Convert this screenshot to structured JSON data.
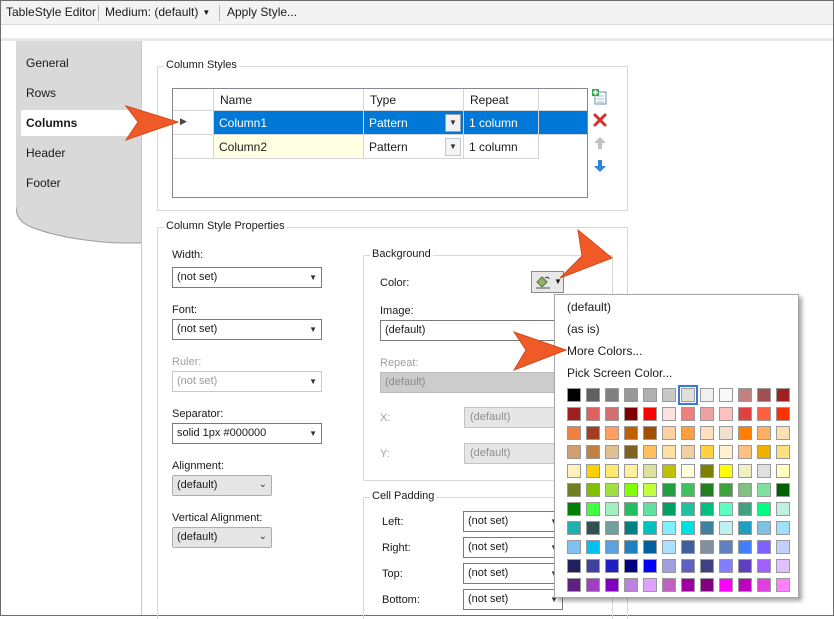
{
  "toolbar": {
    "title": "TableStyle Editor",
    "medium_label": "Medium: (default)",
    "apply_label": "Apply Style..."
  },
  "nav": {
    "items": [
      "General",
      "Rows",
      "Columns",
      "Header",
      "Footer"
    ],
    "selected": "Columns"
  },
  "column_styles": {
    "title": "Column Styles",
    "headers": [
      "Name",
      "Type",
      "Repeat"
    ],
    "rows": [
      {
        "name": "Column1",
        "type": "Pattern",
        "repeat": "1 column",
        "selected": true
      },
      {
        "name": "Column2",
        "type": "Pattern",
        "repeat": "1 column",
        "selected": false
      }
    ],
    "icons": [
      "add-row-icon",
      "delete-row-icon",
      "move-up-icon",
      "move-down-icon"
    ]
  },
  "properties": {
    "title": "Column Style Properties",
    "width_label": "Width:",
    "width_value": "(not set)",
    "font_label": "Font:",
    "font_value": "(not set)",
    "ruler_label": "Ruler:",
    "ruler_value": "(not set)",
    "separator_label": "Separator:",
    "separator_value": "solid 1px #000000",
    "alignment_label": "Alignment:",
    "alignment_value": "(default)",
    "valign_label": "Vertical Alignment:",
    "valign_value": "(default)"
  },
  "background": {
    "title": "Background",
    "color_label": "Color:",
    "image_label": "Image:",
    "image_value": "(default)",
    "repeat_label": "Repeat:",
    "repeat_value": "(default)",
    "x_label": "X:",
    "x_value": "(default)",
    "y_label": "Y:",
    "y_value": "(default)"
  },
  "cell_padding": {
    "title": "Cell Padding",
    "left_label": "Left:",
    "left_value": "(not set)",
    "right_label": "Right:",
    "right_value": "(not set)",
    "top_label": "Top:",
    "top_value": "(not set)",
    "bottom_label": "Bottom:",
    "bottom_value": "(not set)"
  },
  "color_menu": {
    "items": [
      "(default)",
      "(as is)",
      "More Colors...",
      "Pick Screen Color..."
    ],
    "palette": [
      [
        "#000000",
        "#606060",
        "#808080",
        "#989898",
        "#b0b0b0",
        "#c8c8c8",
        "#e0e0e0",
        "#f0f0f0",
        "#f8f8f8",
        "#c08080",
        "#a05050",
        "#a02020"
      ],
      [
        "#a02020",
        "#e06060",
        "#d07070",
        "#800000",
        "#ff0000",
        "#ffe0e0",
        "#f08080",
        "#f0a0a0",
        "#ffc0c0",
        "#e04040",
        "#ff6040",
        "#ff3000"
      ],
      [
        "#f08040",
        "#a04020",
        "#ffa060",
        "#c06000",
        "#a05000",
        "#ffd0a0",
        "#ffa040",
        "#ffe0c0",
        "#f0e0d0",
        "#ff8000",
        "#ffb060",
        "#ffe0b0"
      ],
      [
        "#d0a070",
        "#c08040",
        "#e0c090",
        "#806020",
        "#ffc060",
        "#ffe0a0",
        "#f0d0a0",
        "#ffd040",
        "#fff0d0",
        "#ffc080",
        "#f0b000",
        "#ffe080"
      ],
      [
        "#fff0c0",
        "#ffd000",
        "#ffe870",
        "#fff0a0",
        "#e0e0a0",
        "#c0c000",
        "#ffffe0",
        "#808000",
        "#ffff00",
        "#f0f0c0",
        "#e0e0e0",
        "#ffffc0"
      ],
      [
        "#708020",
        "#80c000",
        "#a0e040",
        "#80ff00",
        "#c0ff40",
        "#20a040",
        "#40c060",
        "#208020",
        "#40a040",
        "#80c080",
        "#80e0a0",
        "#006000"
      ],
      [
        "#008000",
        "#40ff40",
        "#a0f0c0",
        "#20c060",
        "#60e0a0",
        "#00a060",
        "#20c0a0",
        "#00c080",
        "#60ffc0",
        "#40a080",
        "#00ff80",
        "#c0f0e0"
      ],
      [
        "#20b0b0",
        "#305050",
        "#70a0a0",
        "#008080",
        "#00c0c0",
        "#80f0ff",
        "#00e0e0",
        "#4080a0",
        "#c0f0f0",
        "#20a0c0",
        "#80c0e0",
        "#a0e0ff"
      ],
      [
        "#80c0f0",
        "#00c0f0",
        "#60a0e0",
        "#2080c0",
        "#0060a0",
        "#b0e0ff",
        "#4060a0",
        "#8090a0",
        "#6080c0",
        "#4080ff",
        "#8060ff",
        "#c0d0ff"
      ],
      [
        "#202060",
        "#4040a0",
        "#2020c0",
        "#000080",
        "#0000ff",
        "#a0a0e0",
        "#6060c0",
        "#404080",
        "#8080ff",
        "#6040c0",
        "#a060ff",
        "#e0c0ff"
      ],
      [
        "#602080",
        "#a040c0",
        "#8000c0",
        "#c080e0",
        "#e0a0ff",
        "#c060c0",
        "#a000a0",
        "#800080",
        "#ff00ff",
        "#c000c0",
        "#e040e0",
        "#ff80ff"
      ]
    ],
    "selected": [
      0,
      6
    ]
  },
  "colors": {
    "accent": "#0078d7",
    "callout": "#f05a28"
  }
}
